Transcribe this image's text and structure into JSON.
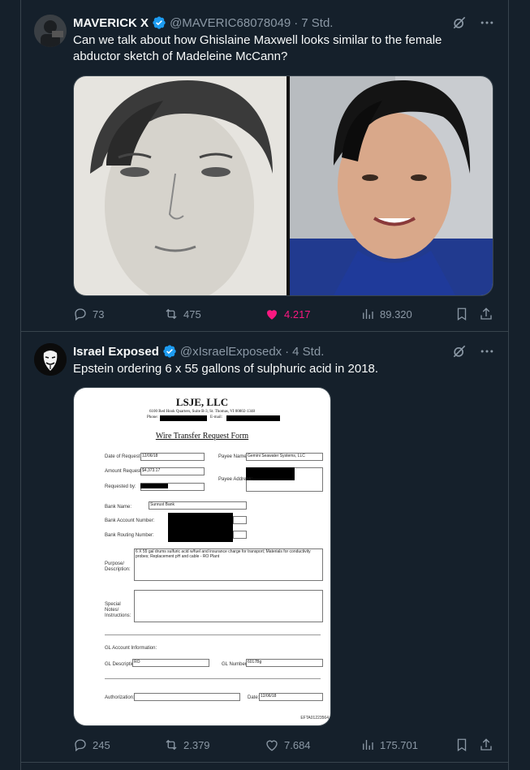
{
  "tweets": [
    {
      "name": "MAVERICK X",
      "handle": "@MAVERIC68078049",
      "time": "7 Std.",
      "text": "Can we talk about how Ghislaine Maxwell looks similar to the female abductor sketch of Madeleine McCann?",
      "replies": "73",
      "reposts": "475",
      "likes": "4.217",
      "views": "89.320",
      "liked": true
    },
    {
      "name": "Israel Exposed",
      "handle": "@xIsraelExposedx",
      "time": "4 Std.",
      "text": "Epstein ordering 6 x 55 gallons of sulphuric acid in 2018.",
      "replies": "245",
      "reposts": "2.379",
      "likes": "7.684",
      "views": "175.701",
      "liked": false
    }
  ],
  "doc": {
    "company": "LSJE, LLC",
    "address": "6100 Red Hook Quarters, Suite B-3, St. Thomas, VI 00802-1348",
    "phone_label": "Phone:",
    "email_label": "E-mail:",
    "form_title": "Wire Transfer Request Form",
    "date_label": "Date of Request:",
    "date_value": "12/06/18",
    "amount_label": "Amount Requested:",
    "amount_value": "$4,373.17",
    "requested_label": "Requested by:",
    "payee_name_label": "Payee Name:",
    "payee_name_value": "Gemini Seawater Systems, LLC",
    "payee_address_label": "Payee Address:",
    "bank_name_label": "Bank Name:",
    "bank_name_value": "Sunrust Bank",
    "bank_account_label": "Bank Account Number:",
    "bank_routing_label": "Bank Routing Number:",
    "purpose_label": "Purpose/ Description:",
    "purpose_value": "6 X 55 gal drums sulfuric acid w/fuel and insurance charge for transport; Materials for conductivity probes; Replacement pH and cable - RO Plant",
    "special_label": "Special Notes/ Instructions:",
    "gl_info_label": "GL Account Information:",
    "gl_desc_label": "GL Description:",
    "gl_desc_value": "RO",
    "gl_number_label": "GL Number:",
    "gl_number_value": "6017Bg",
    "authorization_label": "Authorization:",
    "date2_label": "Date:",
    "date2_value": "12/06/18",
    "doc_id": "EFTA01223564"
  },
  "colors": {
    "background": "#15202b",
    "border": "#38444d",
    "muted": "#8b98a5",
    "like_pink": "#f91880",
    "verified_blue": "#1d9bf0"
  },
  "icons": [
    "verified-badge-icon",
    "grok-icon",
    "more-icon",
    "reply-icon",
    "repost-icon",
    "like-icon",
    "views-icon",
    "bookmark-icon",
    "share-icon"
  ]
}
